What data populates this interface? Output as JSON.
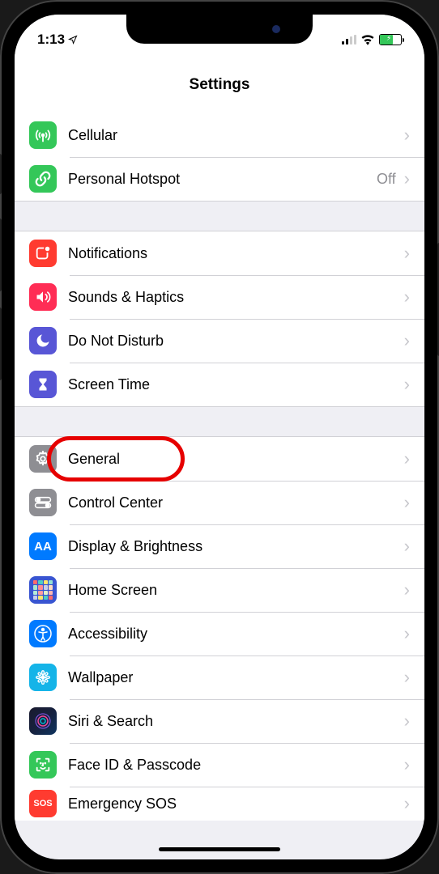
{
  "status": {
    "time": "1:13",
    "signal_active_bars": 2,
    "battery_charging": true
  },
  "header": {
    "title": "Settings"
  },
  "sections": [
    {
      "rows": [
        {
          "key": "cellular",
          "label": "Cellular",
          "icon": "antenna-icon",
          "color": "bg-green",
          "detail": ""
        },
        {
          "key": "hotspot",
          "label": "Personal Hotspot",
          "icon": "link-icon",
          "color": "bg-green",
          "detail": "Off"
        }
      ]
    },
    {
      "rows": [
        {
          "key": "notifications",
          "label": "Notifications",
          "icon": "notification-square-icon",
          "color": "bg-red",
          "detail": ""
        },
        {
          "key": "sounds",
          "label": "Sounds & Haptics",
          "icon": "speaker-icon",
          "color": "bg-redpink",
          "detail": ""
        },
        {
          "key": "dnd",
          "label": "Do Not Disturb",
          "icon": "moon-icon",
          "color": "bg-indigo",
          "detail": ""
        },
        {
          "key": "screentime",
          "label": "Screen Time",
          "icon": "hourglass-icon",
          "color": "bg-indigo",
          "detail": ""
        }
      ]
    },
    {
      "rows": [
        {
          "key": "general",
          "label": "General",
          "icon": "gear-icon",
          "color": "bg-gray",
          "detail": "",
          "highlight": true
        },
        {
          "key": "controlcenter",
          "label": "Control Center",
          "icon": "switches-icon",
          "color": "bg-gray",
          "detail": ""
        },
        {
          "key": "display",
          "label": "Display & Brightness",
          "icon": "aa-icon",
          "color": "bg-blue",
          "detail": ""
        },
        {
          "key": "homescreen",
          "label": "Home Screen",
          "icon": "apps-grid-icon",
          "color": "bg-blue",
          "detail": ""
        },
        {
          "key": "accessibility",
          "label": "Accessibility",
          "icon": "accessibility-icon",
          "color": "bg-blue",
          "detail": ""
        },
        {
          "key": "wallpaper",
          "label": "Wallpaper",
          "icon": "flower-icon",
          "color": "bg-blue",
          "detail": ""
        },
        {
          "key": "siri",
          "label": "Siri & Search",
          "icon": "siri-icon",
          "color": "bg-siri",
          "detail": ""
        },
        {
          "key": "faceid",
          "label": "Face ID & Passcode",
          "icon": "faceid-icon",
          "color": "bg-green",
          "detail": ""
        },
        {
          "key": "sos",
          "label": "Emergency SOS",
          "icon": "sos-icon",
          "color": "bg-red",
          "detail": ""
        }
      ]
    }
  ],
  "icons": {
    "aa_text": "AA",
    "sos_text": "SOS"
  }
}
